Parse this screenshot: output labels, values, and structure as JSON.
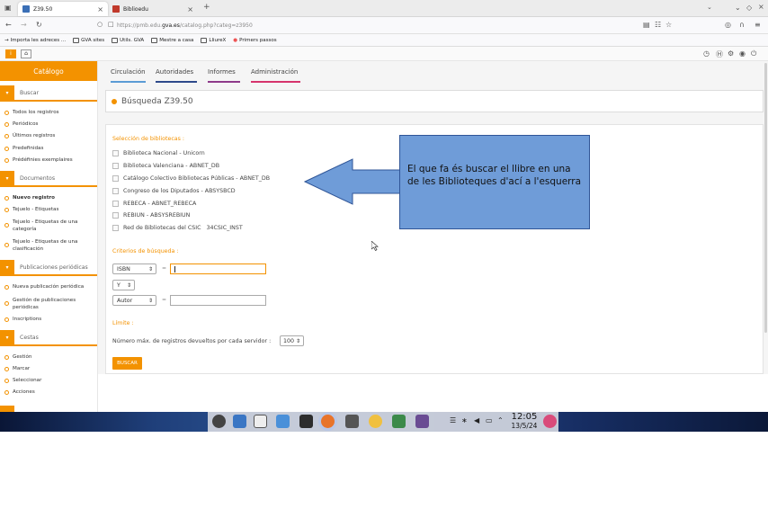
{
  "browser": {
    "tabs": [
      {
        "label": "Z39.50",
        "active": true
      },
      {
        "label": "Biblioedu",
        "active": false
      }
    ],
    "new_tab": "+",
    "url": "https://pmb.edu.gva.es/catalog.php?categ=z3950",
    "url_prefix": "https://pmb.edu.",
    "url_domain": "gva.es",
    "url_path": "/catalog.php?categ=z3950",
    "bookmarks": [
      "Importa les adreces ...",
      "GVA sites",
      "Utils. GVA",
      "Mestre a casa",
      "LliureX",
      "Primers passos"
    ]
  },
  "sidebar": {
    "catalog_label": "Catálogo",
    "sections": [
      {
        "title": "Buscar",
        "items": [
          "Todos los registros",
          "Periódicos",
          "Últimos registros",
          "Predefinidas",
          "Prédéfinies exemplaires"
        ]
      },
      {
        "title": "Documentos",
        "items": [
          "Nuevo registro",
          "Tejuelo - Etiquetas",
          "Tejuelo - Etiquetas de una categoría",
          "Tejuelo - Etiquetas de una clasificación"
        ]
      },
      {
        "title": "Publicaciones periódicas",
        "items": [
          "Nueva publicación periódica",
          "Gestión de publicaciones periódicas",
          "Inscriptions"
        ]
      },
      {
        "title": "Cestas",
        "items": [
          "Gestión",
          "Marcar",
          "Seleccionar",
          "Acciones"
        ]
      }
    ]
  },
  "topnav": {
    "tabs": [
      {
        "label": "Circulación",
        "color": "#5b9bd5"
      },
      {
        "label": "Autoridades",
        "color": "#2e4a8b"
      },
      {
        "label": "Informes",
        "color": "#8e3a8a"
      },
      {
        "label": "Administración",
        "color": "#d6336c"
      }
    ]
  },
  "page": {
    "title": "Búsqueda Z39.50",
    "libraries_label": "Selección de bibliotecas :",
    "libraries": [
      "Biblioteca Nacional - Unicorn",
      "Biblioteca Valenciana - ABNET_DB",
      "Catálogo Colectivo Bibliotecas Públicas - ABNET_DB",
      "Congreso de los Diputados - ABSYSBCD",
      "REBECA - ABNET_REBECA",
      "REBIUN - ABSYSREBIUN",
      "Red de Bibliotecas del CSIC   34CSIC_INST"
    ],
    "criteria_label": "Criterios de búsqueda :",
    "criteria": [
      {
        "field": "ISBN",
        "operator": "=",
        "value": ""
      },
      {
        "field": "Autor",
        "operator": "=",
        "value": ""
      }
    ],
    "bool_op": "Y",
    "limit_label": "Límite :",
    "limit_text": "Número máx. de registros devueltos por cada servidor :",
    "limit_value": "100",
    "search_button": "BUSCAR"
  },
  "annotation": {
    "text": "El que fa és buscar el llibre en una de les Biblioteques d'ací a l'esquerra"
  },
  "taskbar": {
    "time": "12:05",
    "date": "13/5/24"
  },
  "colors": {
    "accent": "#f39200",
    "callout_fill": "#6f9cd8",
    "callout_border": "#2f5597"
  }
}
